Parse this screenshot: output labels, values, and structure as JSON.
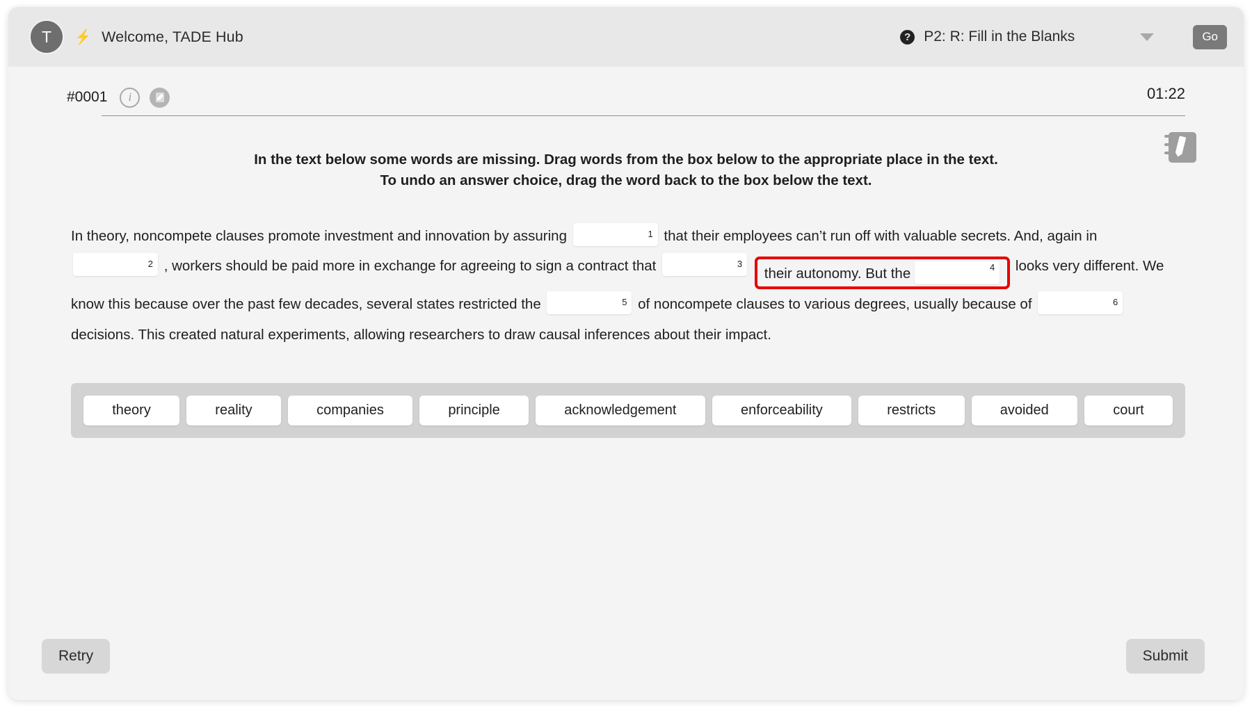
{
  "header": {
    "avatar_initial": "T",
    "bolt_icon": "bolt-icon",
    "welcome_text": "Welcome, TADE Hub",
    "help_icon": "?",
    "task_label": "P2: R: Fill in the Blanks",
    "go_label": "Go"
  },
  "question_bar": {
    "question_number": "#0001",
    "info_icon": "i",
    "timer": "01:22"
  },
  "instructions": {
    "line1": "In the text below some words are missing. Drag words from the box below to the appropriate place in the text.",
    "line2": "To undo an answer choice, drag the word back to the box below the text."
  },
  "passage": {
    "seg1": "In theory, noncompete clauses promote investment and innovation by assuring",
    "blank1": "1",
    "seg2": "that their employees can’t run off with valuable secrets. And, again in",
    "blank2": "2",
    "seg3": ", workers should be paid more in exchange for agreeing to sign a contract that",
    "blank3": "3",
    "seg4": "their autonomy. But the",
    "blank4": "4",
    "seg5": "looks very different. We know this because over the past few decades, several states restricted the",
    "blank5": "5",
    "seg6": "of noncompete clauses to various degrees, usually because of",
    "blank6": "6",
    "seg7": "decisions. This created natural experiments, allowing researchers to draw causal inferences about their impact."
  },
  "word_bank": {
    "words": [
      "theory",
      "reality",
      "companies",
      "principle",
      "acknowledgement",
      "enforceability",
      "restricts",
      "avoided",
      "court"
    ]
  },
  "footer": {
    "retry_label": "Retry",
    "submit_label": "Submit"
  },
  "colors": {
    "highlight": "#e80000",
    "header_bg": "#e8e8e8",
    "card_bg": "#f4f4f4",
    "wordbank_bg": "#d2d2d2"
  }
}
